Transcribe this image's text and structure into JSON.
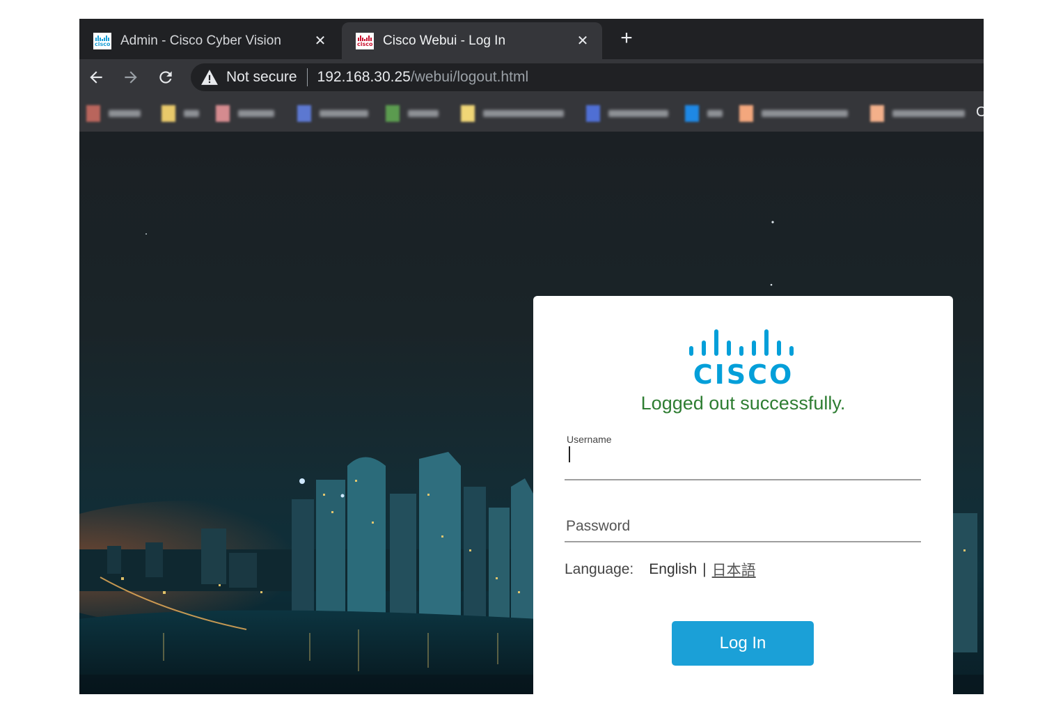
{
  "browser": {
    "tabs": [
      {
        "title": "Admin - Cisco Cyber Vision",
        "favicon_text": "cisco",
        "active": false
      },
      {
        "title": "Cisco Webui - Log In",
        "favicon_text": "cisco",
        "active": true
      }
    ],
    "address_bar": {
      "security_label": "Not secure",
      "url_host": "192.168.30.25",
      "url_path": "/webui/logout.html"
    },
    "bookmarks_overflow_glyph": "C"
  },
  "login": {
    "logo_text": "CISCO",
    "message": "Logged out successfully.",
    "username_label": "Username",
    "username_value": "",
    "password_placeholder": "Password",
    "language_label": "Language:",
    "language_current": "English",
    "language_separator": "|",
    "language_alternate": "日本語",
    "login_button": "Log In"
  },
  "colors": {
    "cisco_blue": "#049fd9",
    "button_blue": "#1ba0d7",
    "success_green": "#2e7d32",
    "chrome_dark": "#202124",
    "chrome_toolbar": "#35363a"
  }
}
